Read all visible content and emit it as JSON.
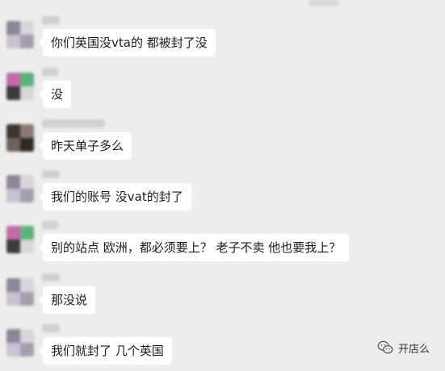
{
  "messages": [
    {
      "name": "",
      "text": "你们英国没vta的 都被封了没"
    },
    {
      "name": "",
      "text": "没"
    },
    {
      "name": "",
      "text": "昨天单子多么"
    },
    {
      "name": "",
      "text": "我们的账号 没vat的封了"
    },
    {
      "name": "",
      "text": "别的站点 欧洲，都必须要上？ 老子不卖 他也要我上？"
    },
    {
      "name": "",
      "text": "那没说"
    },
    {
      "name": "",
      "text": "我们就封了 几个英国"
    }
  ],
  "watermark": {
    "icon": "wechat-icon",
    "text": "开店么"
  },
  "colors": {
    "background": "#ededed",
    "bubble": "#ffffff",
    "text": "#1b1b1b"
  }
}
